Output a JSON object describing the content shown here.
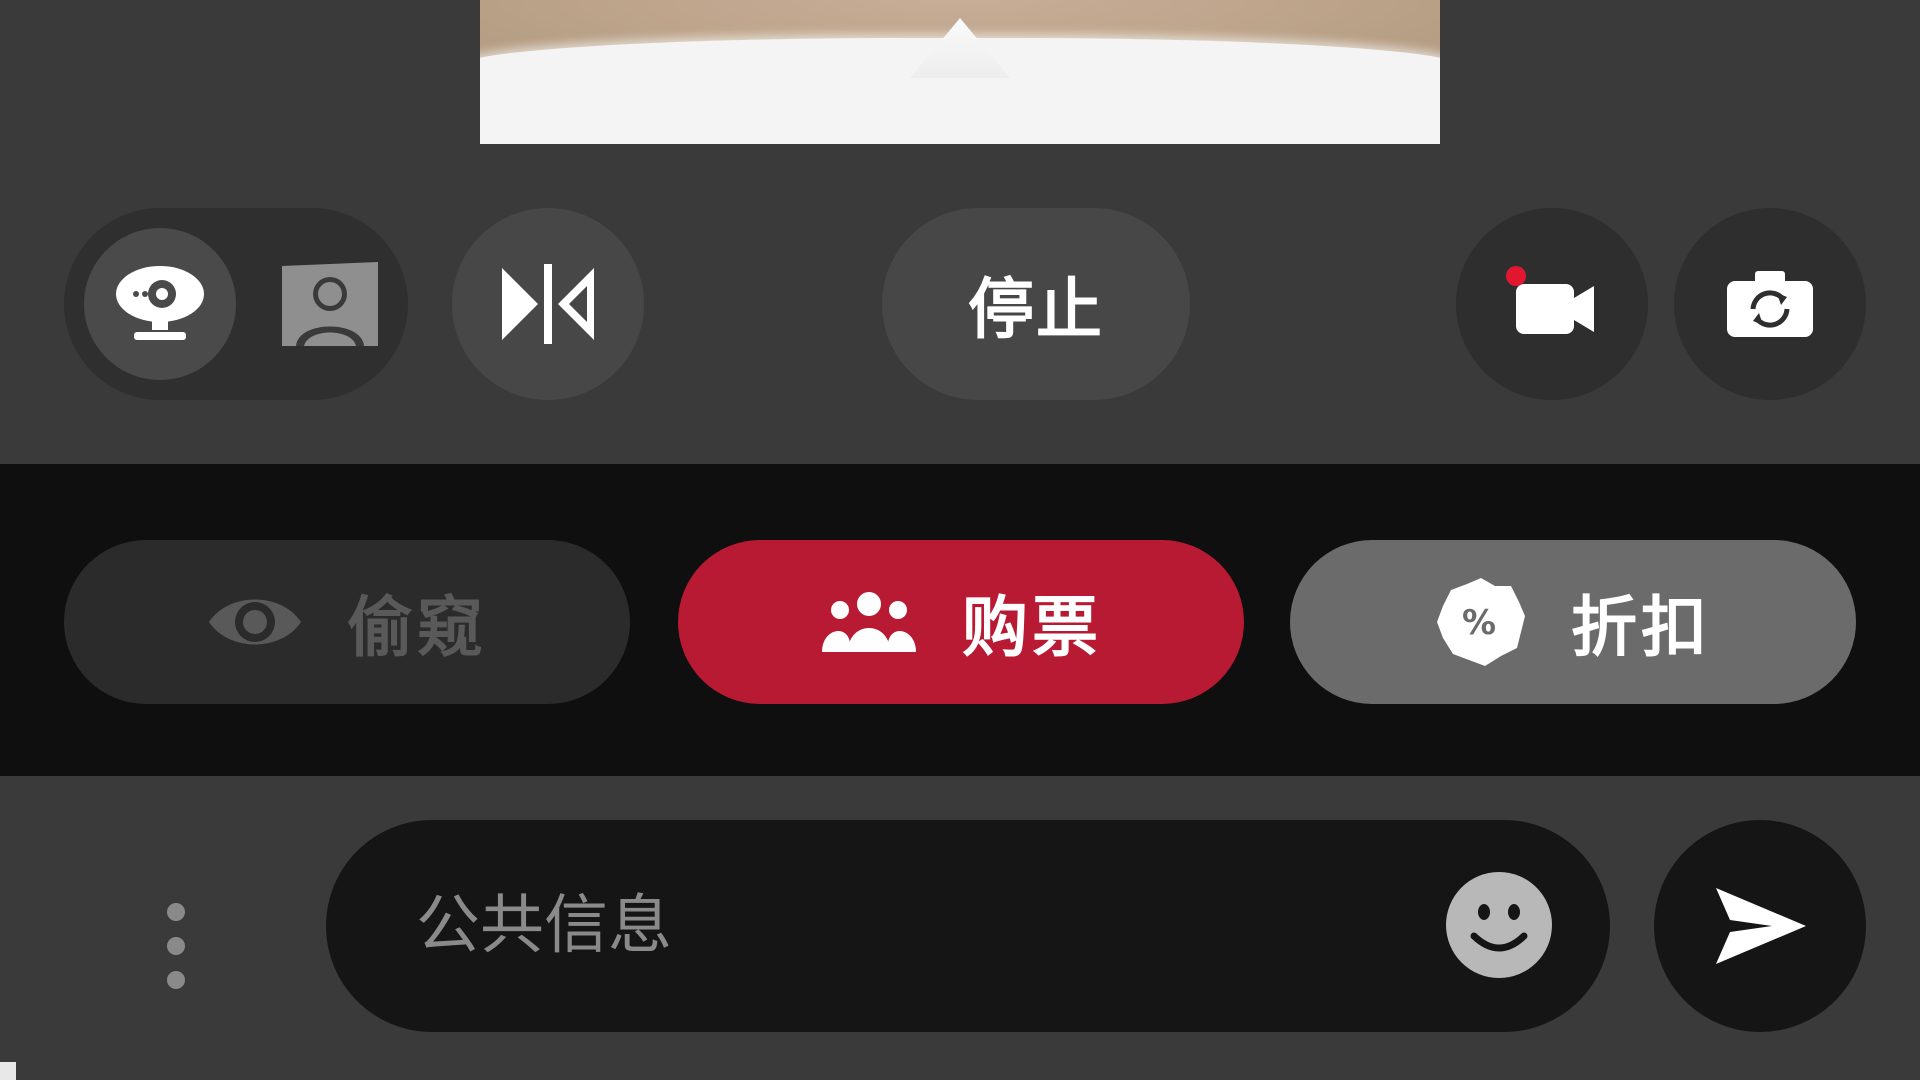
{
  "controls": {
    "view_modes": [
      {
        "icon": "webcam-icon",
        "active": true
      },
      {
        "icon": "person-portrait-icon",
        "active": false
      }
    ],
    "mirror_icon": "mirror-flip-icon",
    "stop_label": "停止",
    "record_icon": "video-record-icon",
    "flip_camera_icon": "switch-camera-icon",
    "record_indicator_color": "#e0172f"
  },
  "actions": {
    "spy": {
      "label": "偷窥",
      "icon": "eye-icon"
    },
    "ticket": {
      "label": "购票",
      "icon": "group-icon"
    },
    "discount": {
      "label": "折扣",
      "icon": "percent-badge-icon"
    }
  },
  "chat": {
    "placeholder": "公共信息",
    "value": "",
    "emoji_icon": "smiley-icon",
    "send_icon": "send-icon",
    "more_icon": "more-vertical-icon"
  },
  "colors": {
    "accent": "#b81a33",
    "panel": "#3a3a3a",
    "action_bar": "#0f0f0f",
    "input_bg": "#151515"
  }
}
